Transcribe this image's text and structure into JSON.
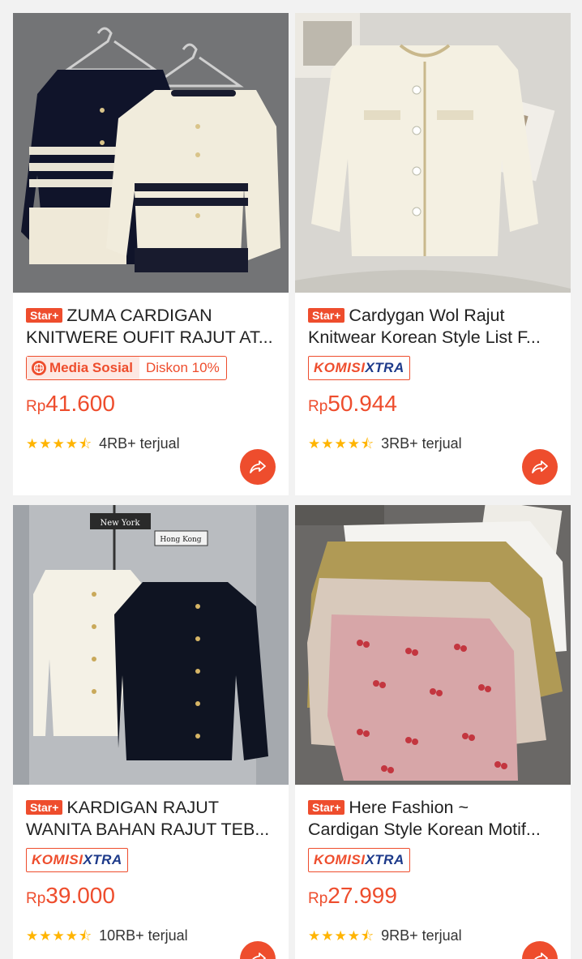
{
  "products": [
    {
      "title_line1": "ZUMA CARDIGAN",
      "title_line2": "KNITWERE OUFIT RAJUT AT...",
      "star_badge": "Star+",
      "badge_type": "media",
      "media_label": "Media Sosial",
      "discount_label": "Diskon 10%",
      "currency": "Rp",
      "price": "41.600",
      "sold": "4RB+ terjual",
      "rating_stars": 4.5,
      "image_icon": "knit-cardigan-photo"
    },
    {
      "title_line1": "Cardygan Wol Rajut",
      "title_line2": "Knitwear Korean Style List F...",
      "star_badge": "Star+",
      "badge_type": "komisi",
      "komisi_part1": "KOMISI",
      "komisi_part2": "XTRA",
      "currency": "Rp",
      "price": "50.944",
      "sold": "3RB+ terjual",
      "rating_stars": 4.5,
      "image_icon": "cream-cardigan-photo"
    },
    {
      "title_line1": "KARDIGAN RAJUT",
      "title_line2": "WANITA BAHAN RAJUT TEB...",
      "star_badge": "Star+",
      "badge_type": "komisi",
      "komisi_part1": "KOMISI",
      "komisi_part2": "XTRA",
      "currency": "Rp",
      "price": "39.000",
      "sold": "10RB+ terjual",
      "rating_stars": 4.5,
      "image_icon": "black-white-cardigan-photo",
      "image_signs": [
        "New York",
        "Hong Kong"
      ]
    },
    {
      "title_line1": "Here Fashion ~",
      "title_line2": "Cardigan Style Korean Motif...",
      "star_badge": "Star+",
      "badge_type": "komisi",
      "komisi_part1": "KOMISI",
      "komisi_part2": "XTRA",
      "currency": "Rp",
      "price": "27.999",
      "sold": "9RB+ terjual",
      "rating_stars": 4.5,
      "image_icon": "cherry-cardigan-photo"
    }
  ],
  "icons": {
    "share": "share-icon",
    "star": "star-icon",
    "globe": "globe-icon"
  },
  "colors": {
    "accent": "#ee4d2d",
    "star": "#ffb400",
    "komisi_blue": "#1d3a8a",
    "background": "#f2f2f2"
  }
}
